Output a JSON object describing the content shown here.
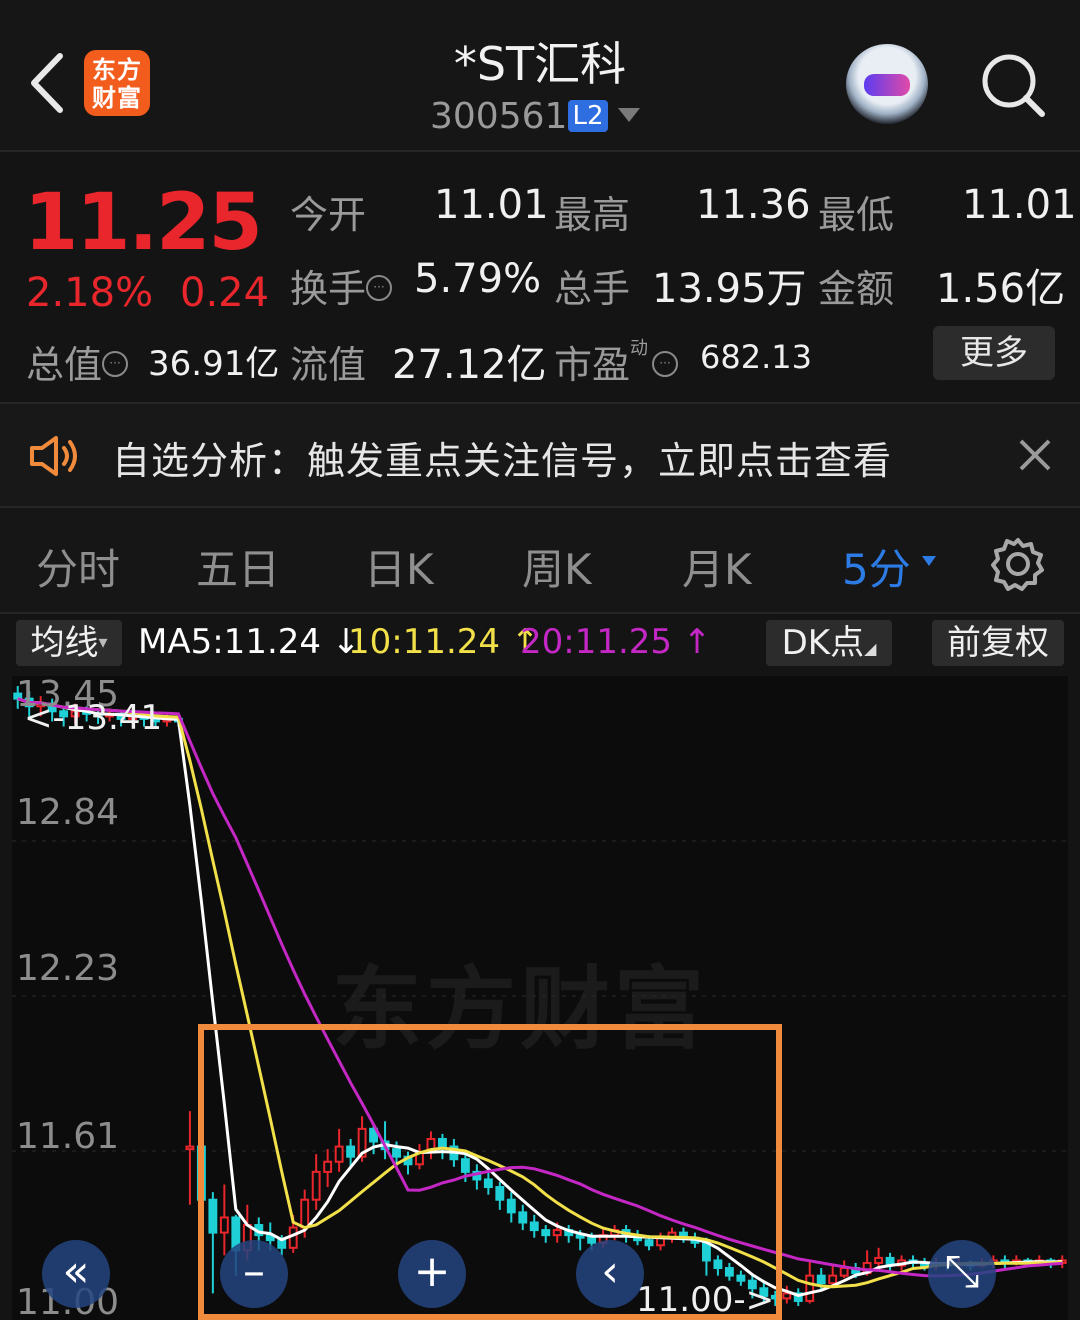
{
  "header": {
    "logo_line1": "东方",
    "logo_line2": "财富",
    "title": "*ST汇科",
    "code": "300561",
    "level_badge": "L2",
    "icons": [
      "back-arrow-icon",
      "avatar-robot-icon",
      "search-icon"
    ]
  },
  "quote": {
    "price": "11.25",
    "change_pct": "2.18%",
    "change_amt": "0.24",
    "fields": {
      "open_label": "今开",
      "open_value": "11.01",
      "high_label": "最高",
      "high_value": "11.36",
      "low_label": "最低",
      "low_value": "11.01",
      "turnover_label": "换手",
      "turnover_value": "5.79%",
      "volume_label": "总手",
      "volume_value": "13.95万",
      "amount_label": "金额",
      "amount_value": "1.56亿",
      "total_cap_label": "总值",
      "total_cap_value": "36.91亿",
      "float_cap_label": "流值",
      "float_cap_value": "27.12亿",
      "pe_label": "市盈",
      "pe_sup": "动",
      "pe_value": "682.13"
    },
    "more_button": "更多",
    "colors": {
      "up": "#e8262c",
      "down": "#1fd1d6"
    }
  },
  "notice": {
    "text": "自选分析：触发重点关注信号，立即点击查看",
    "icons": [
      "speaker-icon",
      "close-icon"
    ]
  },
  "tabs": {
    "items": [
      "分时",
      "五日",
      "日K",
      "周K",
      "月K",
      "5分"
    ],
    "active": "5分",
    "accent": "#2d7be5"
  },
  "indicators": {
    "avg_button": "均线",
    "ma5": "MA5:11.24 ↓",
    "ma10": "10:11.24 ↑",
    "ma20": "20:11.25 ↑",
    "dk_button": "DK点",
    "adjust_button": "前复权",
    "colors": {
      "ma5": "#ffffff",
      "ma10": "#f2e04a",
      "ma20": "#c428c4"
    }
  },
  "chart_data": {
    "type": "candlestick",
    "y_ticks": [
      "13.45",
      "12.84",
      "12.23",
      "11.61",
      "11.00"
    ],
    "ylim": [
      11.0,
      13.45
    ],
    "high_marker": "<-13.41",
    "low_marker": "11.00->",
    "watermark": "东方财富",
    "candles": [
      [
        13.42,
        13.4,
        13.45,
        13.36
      ],
      [
        13.4,
        13.37,
        13.43,
        13.33
      ],
      [
        13.37,
        13.38,
        13.41,
        13.33
      ],
      [
        13.38,
        13.35,
        13.4,
        13.31
      ],
      [
        13.35,
        13.33,
        13.37,
        13.29
      ],
      [
        13.33,
        13.35,
        13.38,
        13.3
      ],
      [
        13.35,
        13.34,
        13.37,
        13.31
      ],
      [
        13.34,
        13.33,
        13.36,
        13.3
      ],
      [
        13.33,
        13.34,
        13.36,
        13.31
      ],
      [
        13.34,
        13.32,
        13.35,
        13.29
      ],
      [
        13.32,
        13.33,
        13.35,
        13.3
      ],
      [
        13.33,
        13.32,
        13.34,
        13.29
      ],
      [
        13.32,
        13.31,
        13.34,
        13.29
      ],
      [
        13.31,
        13.32,
        13.34,
        13.29
      ],
      [
        13.32,
        13.31,
        13.33,
        13.29
      ],
      [
        11.62,
        11.63,
        11.77,
        11.4
      ],
      [
        11.63,
        11.42,
        11.63,
        11.1
      ],
      [
        11.42,
        11.29,
        11.45,
        11.05
      ],
      [
        11.29,
        11.35,
        11.48,
        11.2
      ],
      [
        11.35,
        11.22,
        11.36,
        11.12
      ],
      [
        11.22,
        11.32,
        11.4,
        11.18
      ],
      [
        11.32,
        11.28,
        11.35,
        11.22
      ],
      [
        11.28,
        11.26,
        11.33,
        11.22
      ],
      [
        11.26,
        11.23,
        11.28,
        11.2
      ],
      [
        11.23,
        11.31,
        11.36,
        11.21
      ],
      [
        11.31,
        11.42,
        11.46,
        11.27
      ],
      [
        11.42,
        11.53,
        11.6,
        11.38
      ],
      [
        11.53,
        11.57,
        11.62,
        11.47
      ],
      [
        11.57,
        11.63,
        11.7,
        11.53
      ],
      [
        11.63,
        11.59,
        11.66,
        11.55
      ],
      [
        11.59,
        11.7,
        11.75,
        11.57
      ],
      [
        11.7,
        11.65,
        11.72,
        11.6
      ],
      [
        11.65,
        11.62,
        11.73,
        11.58
      ],
      [
        11.62,
        11.59,
        11.65,
        11.55
      ],
      [
        11.59,
        11.56,
        11.61,
        11.52
      ],
      [
        11.56,
        11.61,
        11.64,
        11.54
      ],
      [
        11.61,
        11.66,
        11.69,
        11.58
      ],
      [
        11.66,
        11.63,
        11.68,
        11.58
      ],
      [
        11.63,
        11.58,
        11.66,
        11.55
      ],
      [
        11.58,
        11.53,
        11.6,
        11.49
      ],
      [
        11.53,
        11.5,
        11.56,
        11.46
      ],
      [
        11.5,
        11.47,
        11.53,
        11.44
      ],
      [
        11.47,
        11.42,
        11.49,
        11.38
      ],
      [
        11.42,
        11.37,
        11.45,
        11.33
      ],
      [
        11.37,
        11.33,
        11.4,
        11.3
      ],
      [
        11.33,
        11.3,
        11.36,
        11.27
      ],
      [
        11.3,
        11.28,
        11.32,
        11.25
      ],
      [
        11.28,
        11.3,
        11.33,
        11.25
      ],
      [
        11.3,
        11.28,
        11.32,
        11.25
      ],
      [
        11.28,
        11.27,
        11.3,
        11.22
      ],
      [
        11.27,
        11.25,
        11.29,
        11.22
      ],
      [
        11.25,
        11.28,
        11.31,
        11.23
      ],
      [
        11.28,
        11.3,
        11.32,
        11.26
      ],
      [
        11.3,
        11.28,
        11.32,
        11.25
      ],
      [
        11.28,
        11.26,
        11.3,
        11.24
      ],
      [
        11.26,
        11.24,
        11.28,
        11.22
      ],
      [
        11.24,
        11.27,
        11.29,
        11.22
      ],
      [
        11.27,
        11.29,
        11.31,
        11.25
      ],
      [
        11.29,
        11.27,
        11.31,
        11.25
      ],
      [
        11.27,
        11.25,
        11.29,
        11.23
      ],
      [
        11.25,
        11.18,
        11.27,
        11.12
      ],
      [
        11.18,
        11.15,
        11.2,
        11.12
      ],
      [
        11.15,
        11.12,
        11.17,
        11.1
      ],
      [
        11.12,
        11.1,
        11.14,
        11.08
      ],
      [
        11.1,
        11.07,
        11.12,
        11.03
      ],
      [
        11.07,
        11.04,
        11.1,
        11.01
      ],
      [
        11.04,
        11.03,
        11.06,
        11.0
      ],
      [
        11.03,
        11.05,
        11.08,
        11.01
      ],
      [
        11.05,
        11.02,
        11.07,
        11.0
      ],
      [
        11.02,
        11.12,
        11.18,
        11.01
      ],
      [
        11.12,
        11.09,
        11.15,
        11.06
      ],
      [
        11.09,
        11.12,
        11.16,
        11.08
      ],
      [
        11.12,
        11.15,
        11.18,
        11.11
      ],
      [
        11.15,
        11.13,
        11.17,
        11.11
      ],
      [
        11.13,
        11.17,
        11.22,
        11.12
      ],
      [
        11.17,
        11.19,
        11.23,
        11.15
      ],
      [
        11.19,
        11.16,
        11.21,
        11.13
      ],
      [
        11.16,
        11.18,
        11.2,
        11.14
      ],
      [
        11.18,
        11.17,
        11.2,
        11.15
      ],
      [
        11.17,
        11.16,
        11.19,
        11.14
      ],
      [
        11.16,
        11.17,
        11.19,
        11.14
      ],
      [
        11.17,
        11.16,
        11.18,
        11.14
      ],
      [
        11.16,
        11.17,
        11.19,
        11.14
      ],
      [
        11.17,
        11.16,
        11.18,
        11.14
      ],
      [
        11.16,
        11.17,
        11.19,
        11.15
      ],
      [
        11.17,
        11.18,
        11.2,
        11.15
      ],
      [
        11.18,
        11.17,
        11.2,
        11.15
      ],
      [
        11.17,
        11.18,
        11.2,
        11.16
      ],
      [
        11.18,
        11.17,
        11.19,
        11.16
      ],
      [
        11.17,
        11.18,
        11.2,
        11.16
      ],
      [
        11.18,
        11.17,
        11.19,
        11.15
      ],
      [
        11.17,
        11.18,
        11.2,
        11.15
      ]
    ],
    "overlay_buttons": [
      "double-left-icon",
      "zoom-out-icon",
      "zoom-in-icon",
      "left-arrow-icon",
      "expand-icon"
    ]
  }
}
